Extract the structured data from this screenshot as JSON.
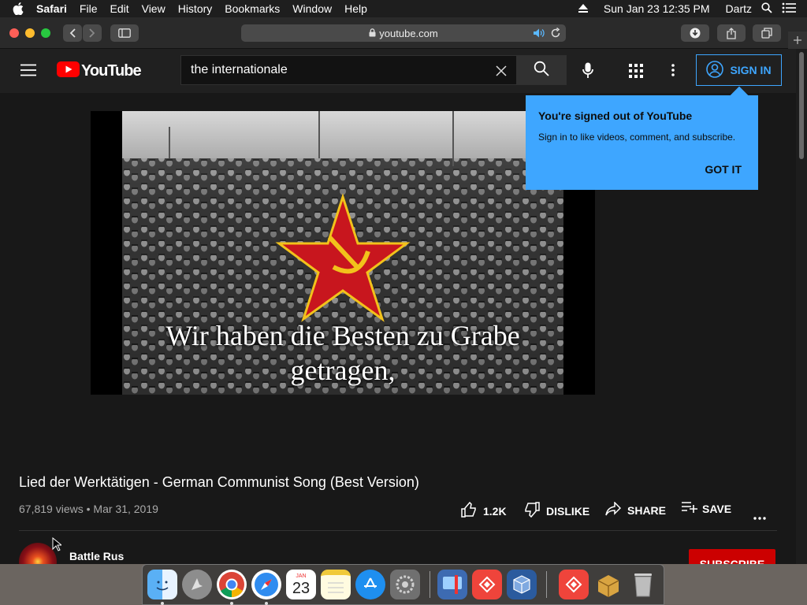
{
  "menubar": {
    "app": "Safari",
    "items": [
      "File",
      "Edit",
      "View",
      "History",
      "Bookmarks",
      "Window",
      "Help"
    ],
    "datetime": "Sun Jan 23 12:35 PM",
    "user": "Dartz"
  },
  "browser": {
    "url": "youtube.com"
  },
  "youtube": {
    "logo_text": "YouTube",
    "search_value": "the internationale",
    "sign_in_label": "SIGN IN",
    "signed_out_popup": {
      "title": "You're signed out of YouTube",
      "body": "Sign in to like videos, comment, and subscribe.",
      "action": "GOT IT"
    },
    "video": {
      "subtitle_line1": "Wir haben die Besten zu Grabe",
      "subtitle_line2": "getragen,",
      "title": "Lied der Werktätigen - German Communist Song (Best Version)",
      "views": "67,819 views",
      "date": "Mar 31, 2019",
      "likes": "1.2K",
      "dislike_label": "DISLIKE",
      "share_label": "SHARE",
      "save_label": "SAVE",
      "channel": "Battle Rus",
      "subscribe_label": "SUBSCRIBE"
    }
  },
  "dock": {
    "calendar_month": "JAN",
    "calendar_day": "23",
    "apps": [
      "finder",
      "launchpad",
      "chrome",
      "safari",
      "calendar",
      "notes",
      "app-store",
      "system-preferences",
      "screen-sharing",
      "anydesk",
      "virtualbox",
      "anydesk-2",
      "archive-utility",
      "trash"
    ]
  },
  "colors": {
    "youtube_red": "#ff0000",
    "accent_blue": "#3ea6ff",
    "subscribe_red": "#cc0000"
  }
}
